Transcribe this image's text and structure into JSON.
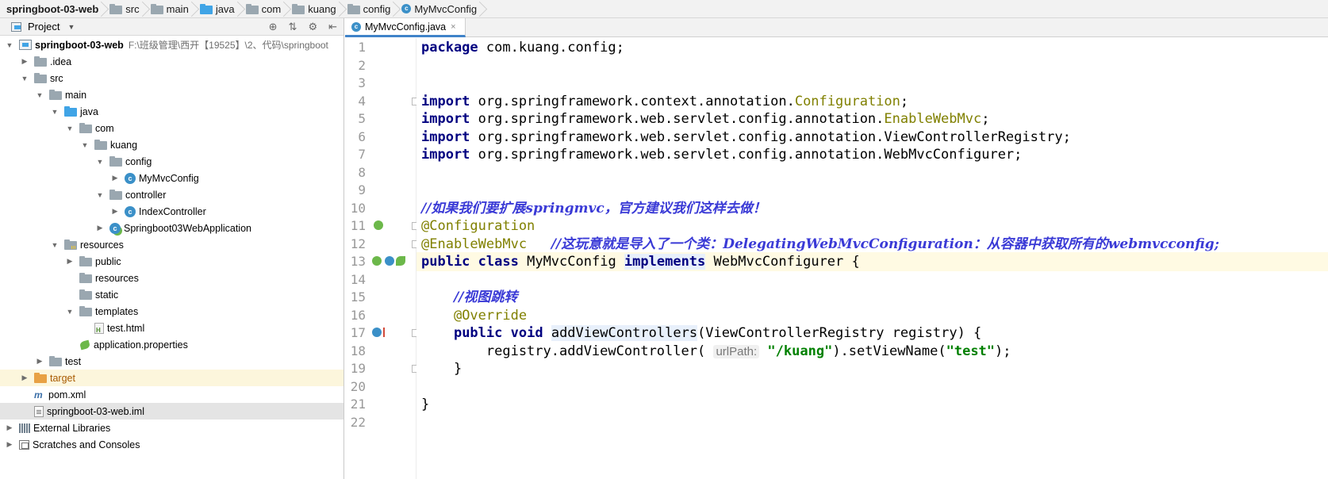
{
  "breadcrumb": [
    {
      "label": "springboot-03-web",
      "bold": true,
      "icon": "none"
    },
    {
      "label": "src",
      "icon": "folder-icon"
    },
    {
      "label": "main",
      "icon": "folder-icon"
    },
    {
      "label": "java",
      "icon": "folder-blue-icon"
    },
    {
      "label": "com",
      "icon": "folder-icon"
    },
    {
      "label": "kuang",
      "icon": "folder-icon"
    },
    {
      "label": "config",
      "icon": "folder-icon"
    },
    {
      "label": "MyMvcConfig",
      "icon": "class-icon"
    }
  ],
  "project_panel": {
    "title": "Project",
    "tree": [
      {
        "label": "springboot-03-web",
        "path": "F:\\班级管理\\西开【19525】\\2、代码\\springboot",
        "depth": 0,
        "arrow": "open",
        "icon": "module",
        "bold": true
      },
      {
        "label": ".idea",
        "depth": 1,
        "arrow": "closed",
        "icon": "folder"
      },
      {
        "label": "src",
        "depth": 1,
        "arrow": "open",
        "icon": "folder"
      },
      {
        "label": "main",
        "depth": 2,
        "arrow": "open",
        "icon": "folder"
      },
      {
        "label": "java",
        "depth": 3,
        "arrow": "open",
        "icon": "folder-blue"
      },
      {
        "label": "com",
        "depth": 4,
        "arrow": "open",
        "icon": "folder"
      },
      {
        "label": "kuang",
        "depth": 5,
        "arrow": "open",
        "icon": "folder"
      },
      {
        "label": "config",
        "depth": 6,
        "arrow": "open",
        "icon": "folder"
      },
      {
        "label": "MyMvcConfig",
        "depth": 7,
        "arrow": "closed",
        "icon": "class"
      },
      {
        "label": "controller",
        "depth": 6,
        "arrow": "open",
        "icon": "folder"
      },
      {
        "label": "IndexController",
        "depth": 7,
        "arrow": "closed",
        "icon": "class"
      },
      {
        "label": "Springboot03WebApplication",
        "depth": 6,
        "arrow": "closed",
        "icon": "spring-class"
      },
      {
        "label": "resources",
        "depth": 3,
        "arrow": "open",
        "icon": "folder-res"
      },
      {
        "label": "public",
        "depth": 4,
        "arrow": "closed",
        "icon": "folder"
      },
      {
        "label": "resources",
        "depth": 4,
        "arrow": "none",
        "icon": "folder"
      },
      {
        "label": "static",
        "depth": 4,
        "arrow": "none",
        "icon": "folder"
      },
      {
        "label": "templates",
        "depth": 4,
        "arrow": "open",
        "icon": "folder"
      },
      {
        "label": "test.html",
        "depth": 5,
        "arrow": "none",
        "icon": "html"
      },
      {
        "label": "application.properties",
        "depth": 4,
        "arrow": "none",
        "icon": "properties"
      },
      {
        "label": "test",
        "depth": 2,
        "arrow": "closed",
        "icon": "folder"
      },
      {
        "label": "target",
        "depth": 1,
        "arrow": "closed",
        "icon": "folder-orange",
        "highlight": true,
        "orange": true
      },
      {
        "label": "pom.xml",
        "depth": 1,
        "arrow": "none",
        "icon": "pom"
      },
      {
        "label": "springboot-03-web.iml",
        "depth": 1,
        "arrow": "none",
        "icon": "iml",
        "selected": true
      },
      {
        "label": "External Libraries",
        "depth": 0,
        "arrow": "closed",
        "icon": "libraries"
      },
      {
        "label": "Scratches and Consoles",
        "depth": 0,
        "arrow": "closed",
        "icon": "scratches"
      }
    ]
  },
  "editor": {
    "tab_label": "MyMvcConfig.java",
    "caret_line": 13,
    "lines": [
      [
        {
          "t": "package",
          "c": "kw"
        },
        {
          "t": " com.kuang.config;"
        }
      ],
      [],
      [],
      [
        {
          "t": "import",
          "c": "kw"
        },
        {
          "t": " org.springframework.context.annotation."
        },
        {
          "t": "Configuration",
          "c": "ann"
        },
        {
          "t": ";"
        }
      ],
      [
        {
          "t": "import",
          "c": "kw"
        },
        {
          "t": " org.springframework.web.servlet.config.annotation."
        },
        {
          "t": "EnableWebMvc",
          "c": "ann"
        },
        {
          "t": ";"
        }
      ],
      [
        {
          "t": "import",
          "c": "kw"
        },
        {
          "t": " org.springframework.web.servlet.config.annotation.ViewControllerRegistry;"
        }
      ],
      [
        {
          "t": "import",
          "c": "kw"
        },
        {
          "t": " org.springframework.web.servlet.config.annotation.WebMvcConfigurer;"
        }
      ],
      [],
      [],
      [
        {
          "t": "//如果我们要扩展springmvc，官方建议我们这样去做！",
          "c": "cm"
        }
      ],
      [
        {
          "t": "@Configuration",
          "c": "ann"
        }
      ],
      [
        {
          "t": "@EnableWebMvc",
          "c": "ann"
        },
        {
          "t": "   "
        },
        {
          "t": "//这玩意就是导入了一个类：DelegatingWebMvcConfiguration：从容器中获取所有的webmvcconfig;",
          "c": "cm"
        }
      ],
      [
        {
          "t": "public",
          "c": "kw"
        },
        {
          "t": " "
        },
        {
          "t": "class",
          "c": "kw"
        },
        {
          "t": " MyMvcConfig "
        },
        {
          "t": "implements",
          "c": "kw method"
        },
        {
          "t": " WebMvcConfigurer {"
        }
      ],
      [],
      [
        {
          "t": "    "
        },
        {
          "t": "//视图跳转",
          "c": "cm"
        }
      ],
      [
        {
          "t": "    "
        },
        {
          "t": "@Override",
          "c": "ann"
        }
      ],
      [
        {
          "t": "    "
        },
        {
          "t": "public",
          "c": "kw"
        },
        {
          "t": " "
        },
        {
          "t": "void",
          "c": "kw"
        },
        {
          "t": " "
        },
        {
          "t": "addViewControllers",
          "c": "method"
        },
        {
          "t": "(ViewControllerRegistry registry) {"
        }
      ],
      [
        {
          "t": "        registry.addViewController( "
        },
        {
          "t": "urlPath:",
          "c": "hint"
        },
        {
          "t": " "
        },
        {
          "t": "\"/kuang\"",
          "c": "str"
        },
        {
          "t": ").setViewName("
        },
        {
          "t": "\"test\"",
          "c": "str"
        },
        {
          "t": ");"
        }
      ],
      [
        {
          "t": "    }"
        }
      ],
      [],
      [
        {
          "t": "}"
        }
      ],
      []
    ]
  }
}
